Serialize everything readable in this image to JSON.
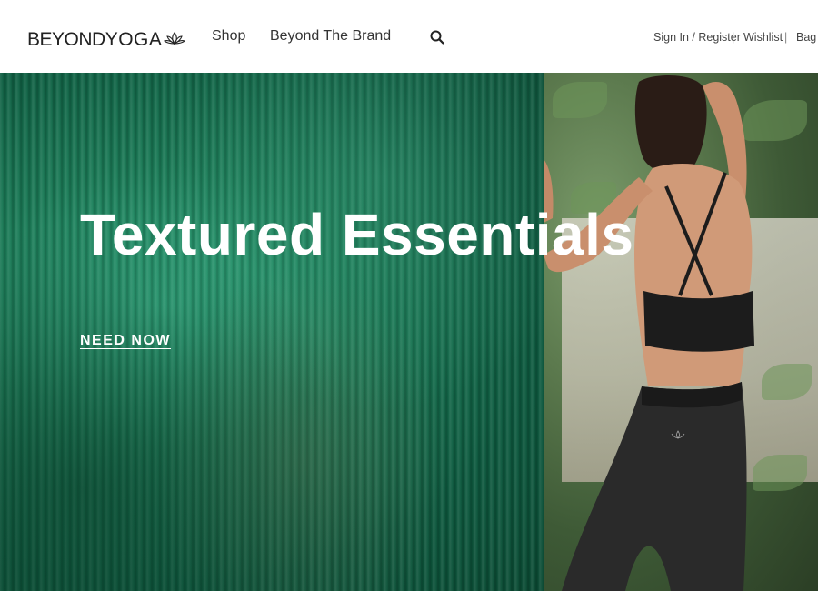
{
  "header": {
    "logo": {
      "part1": "BEYOND",
      "part2": "YOGA",
      "icon": "lotus-icon"
    },
    "nav": {
      "shop": "Shop",
      "brand": "Beyond The Brand"
    },
    "search_icon": "search-icon",
    "utility": {
      "sign_in": "Sign In / Register",
      "separator": "|",
      "wishlist": "Wishlist",
      "bag": "Bag"
    }
  },
  "hero": {
    "title": "Textured Essentials",
    "cta": "NEED NOW"
  },
  "colors": {
    "header_bg": "#ffffff",
    "hero_green": "#1a7a56",
    "hero_text": "#ffffff"
  }
}
